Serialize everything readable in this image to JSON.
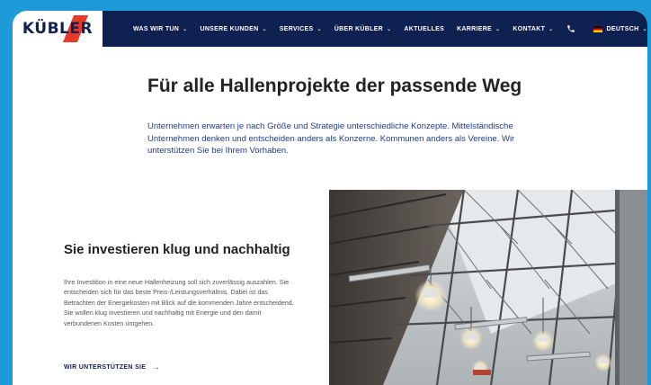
{
  "logo": {
    "text": "KÜBLER",
    "accent_color": "#e8392b"
  },
  "nav": {
    "background": "#0f2150",
    "items": [
      {
        "label": "WAS WIR TUN",
        "has_dropdown": true
      },
      {
        "label": "UNSERE KUNDEN",
        "has_dropdown": true
      },
      {
        "label": "SERVICES",
        "has_dropdown": true
      },
      {
        "label": "ÜBER KÜBLER",
        "has_dropdown": true
      },
      {
        "label": "AKTUELLES",
        "has_dropdown": false
      },
      {
        "label": "KARRIERE",
        "has_dropdown": true
      },
      {
        "label": "KONTAKT",
        "has_dropdown": true
      }
    ],
    "phone_icon": "phone-icon",
    "language": {
      "label": "DEUTSCH",
      "flag": "de-flag-icon"
    },
    "search_icon": "search-icon"
  },
  "hero": {
    "title": "Für alle Hallenprojekte der passende Weg",
    "intro": "Unternehmen erwarten je nach Größe und Strategie unterschiedliche Konzepte. Mittelständische Unternehmen denken und entscheiden anders als Konzerne. Kommunen anders als Vereine. Wir unterstützen Sie bei Ihrem Vorhaben."
  },
  "section": {
    "title": "Sie investieren klug und nachhaltig",
    "body": "Ihre Investition in eine neue Hallenheizung soll sich zuverlässig auszahlen. Sie entscheiden sich für das beste Preis-/Leistungsverhältnis. Dabei ist das Betrachten der Energiekosten mit Blick auf die kommenden Jahre entscheidend. Sie wollen klug investieren und nachhaltig mit Energie und den damit verbundenen Kosten umgehen.",
    "cta_label": "WIR UNTERSTÜTZEN SIE",
    "cta_arrow": "→"
  },
  "image": {
    "subject": "industrial hall roof with heating units and lamps"
  },
  "colors": {
    "frame": "#1e9ad8",
    "navy": "#0f2150",
    "accent": "#e8392b",
    "intro_text": "#1e3c8c"
  }
}
